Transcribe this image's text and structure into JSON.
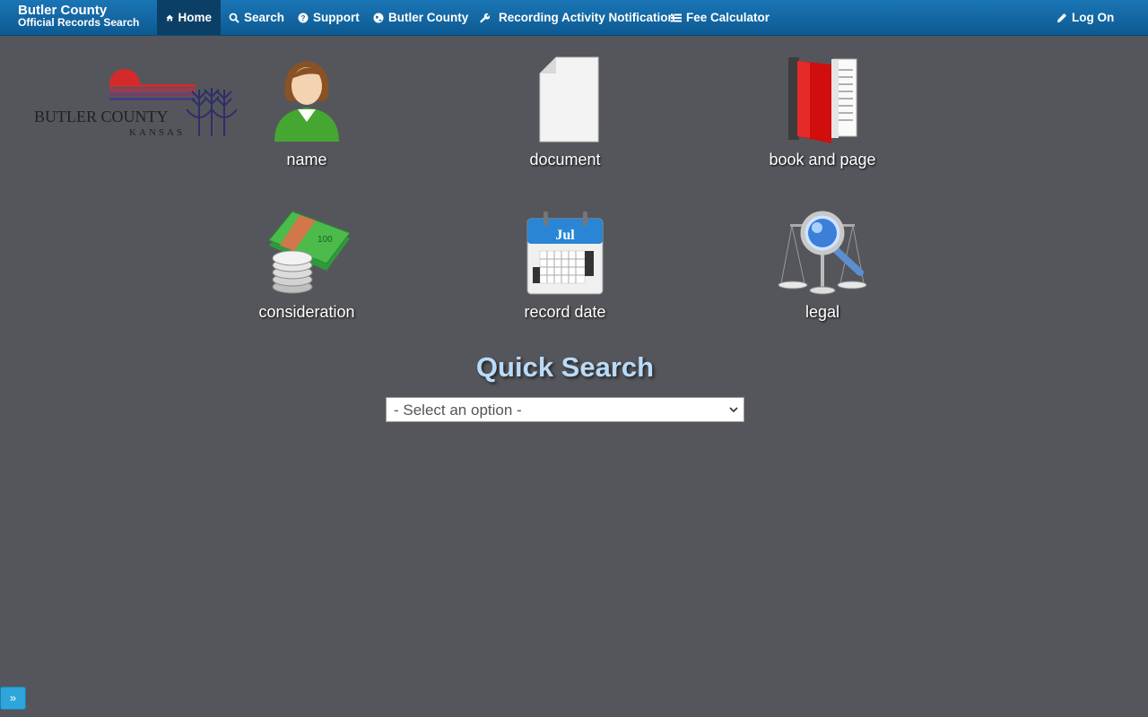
{
  "brand": {
    "line1": "Butler County",
    "line2": "Official Records Search"
  },
  "nav": {
    "items": [
      {
        "label": "Home",
        "icon": "home-icon"
      },
      {
        "label": "Search",
        "icon": "search-icon"
      },
      {
        "label": "Support",
        "icon": "question-icon"
      },
      {
        "label": "Butler County",
        "icon": "globe-icon"
      },
      {
        "label": "Recording Activity Notification",
        "icon": "wrench-icon"
      },
      {
        "label": "Fee Calculator",
        "icon": "list-icon"
      }
    ],
    "logon": {
      "label": "Log On",
      "icon": "pencil-icon"
    }
  },
  "logo": {
    "text_main": "BUTLER COUNTY",
    "text_sub": "KANSAS"
  },
  "tiles": [
    {
      "label": "name",
      "icon": "person-icon"
    },
    {
      "label": "document",
      "icon": "document-icon"
    },
    {
      "label": "book and page",
      "icon": "book-icon"
    },
    {
      "label": "consideration",
      "icon": "money-icon"
    },
    {
      "label": "record date",
      "icon": "calendar-icon",
      "calendar_month": "Jul"
    },
    {
      "label": "legal",
      "icon": "scales-magnifier-icon"
    }
  ],
  "quick_search": {
    "title": "Quick Search",
    "select_value": "- Select an option -"
  },
  "expander": {
    "label": "»"
  },
  "colors": {
    "navbar": "#0f63a0",
    "background": "#55565b",
    "accent_title": "#b9daf8"
  }
}
